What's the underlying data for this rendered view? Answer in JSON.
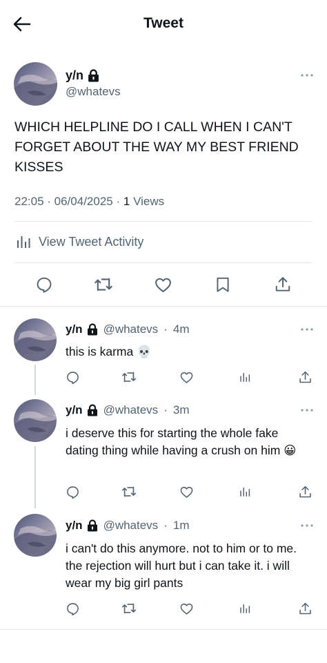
{
  "header": {
    "title": "Tweet"
  },
  "tweet": {
    "name": "y/n",
    "handle": "@whatevs",
    "text": "WHICH HELPLINE DO I CALL WHEN I CAN'T FORGET ABOUT THE WAY MY BEST FRIEND KISSES",
    "time": "22:05",
    "date": "06/04/2025",
    "views_count": "1",
    "views_label": "Views",
    "activity_label": "View Tweet Activity"
  },
  "replies": [
    {
      "name": "y/n",
      "handle": "@whatevs",
      "age": "4m",
      "text": "this is karma 💀"
    },
    {
      "name": "y/n",
      "handle": "@whatevs",
      "age": "3m",
      "text": "i deserve this for starting the whole fake dating thing while having a crush on him 😀"
    },
    {
      "name": "y/n",
      "handle": "@whatevs",
      "age": "1m",
      "text": "i can't do this anymore. not to him or to me. the rejection will hurt but i can take it. i will wear my big girl pants"
    }
  ],
  "colors": {
    "text": "#0f1419",
    "secondary": "#536471",
    "divider": "#e6e9eb",
    "thread": "#cfd9de"
  }
}
